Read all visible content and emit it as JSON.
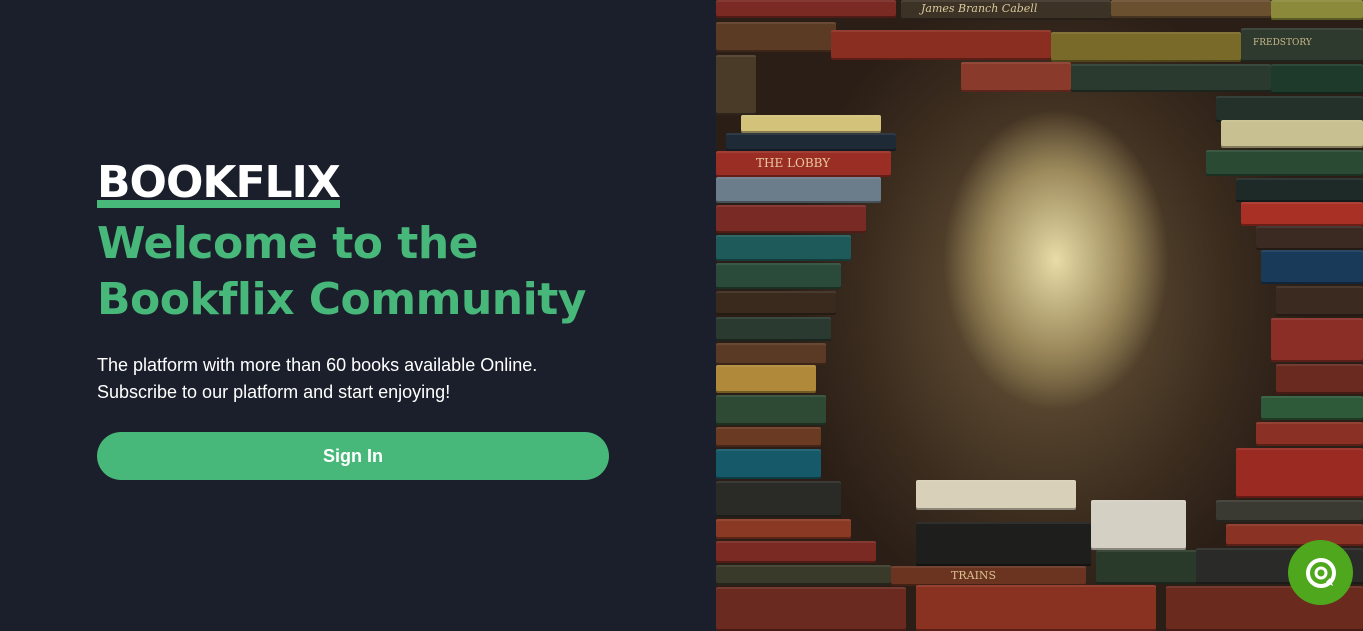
{
  "brand": {
    "logo": "BOOKFLIX"
  },
  "hero": {
    "title_line1": "Welcome to the",
    "title_line2": "Bookflix Community",
    "desc_line1": "The platform with more than 60 books available Online.",
    "desc_line2": "Subscribe to our platform and start enjoying!",
    "signin_label": "Sign In"
  },
  "image": {
    "spine_texts": [
      "James Branch Cabell",
      "FREDSTORY",
      "THE LOBBY",
      "TRAINS"
    ]
  },
  "colors": {
    "background": "#1b1f2b",
    "accent": "#47b87a",
    "chat_button": "#4ea71c"
  },
  "icons": {
    "chat": "chat-bubble-icon"
  }
}
